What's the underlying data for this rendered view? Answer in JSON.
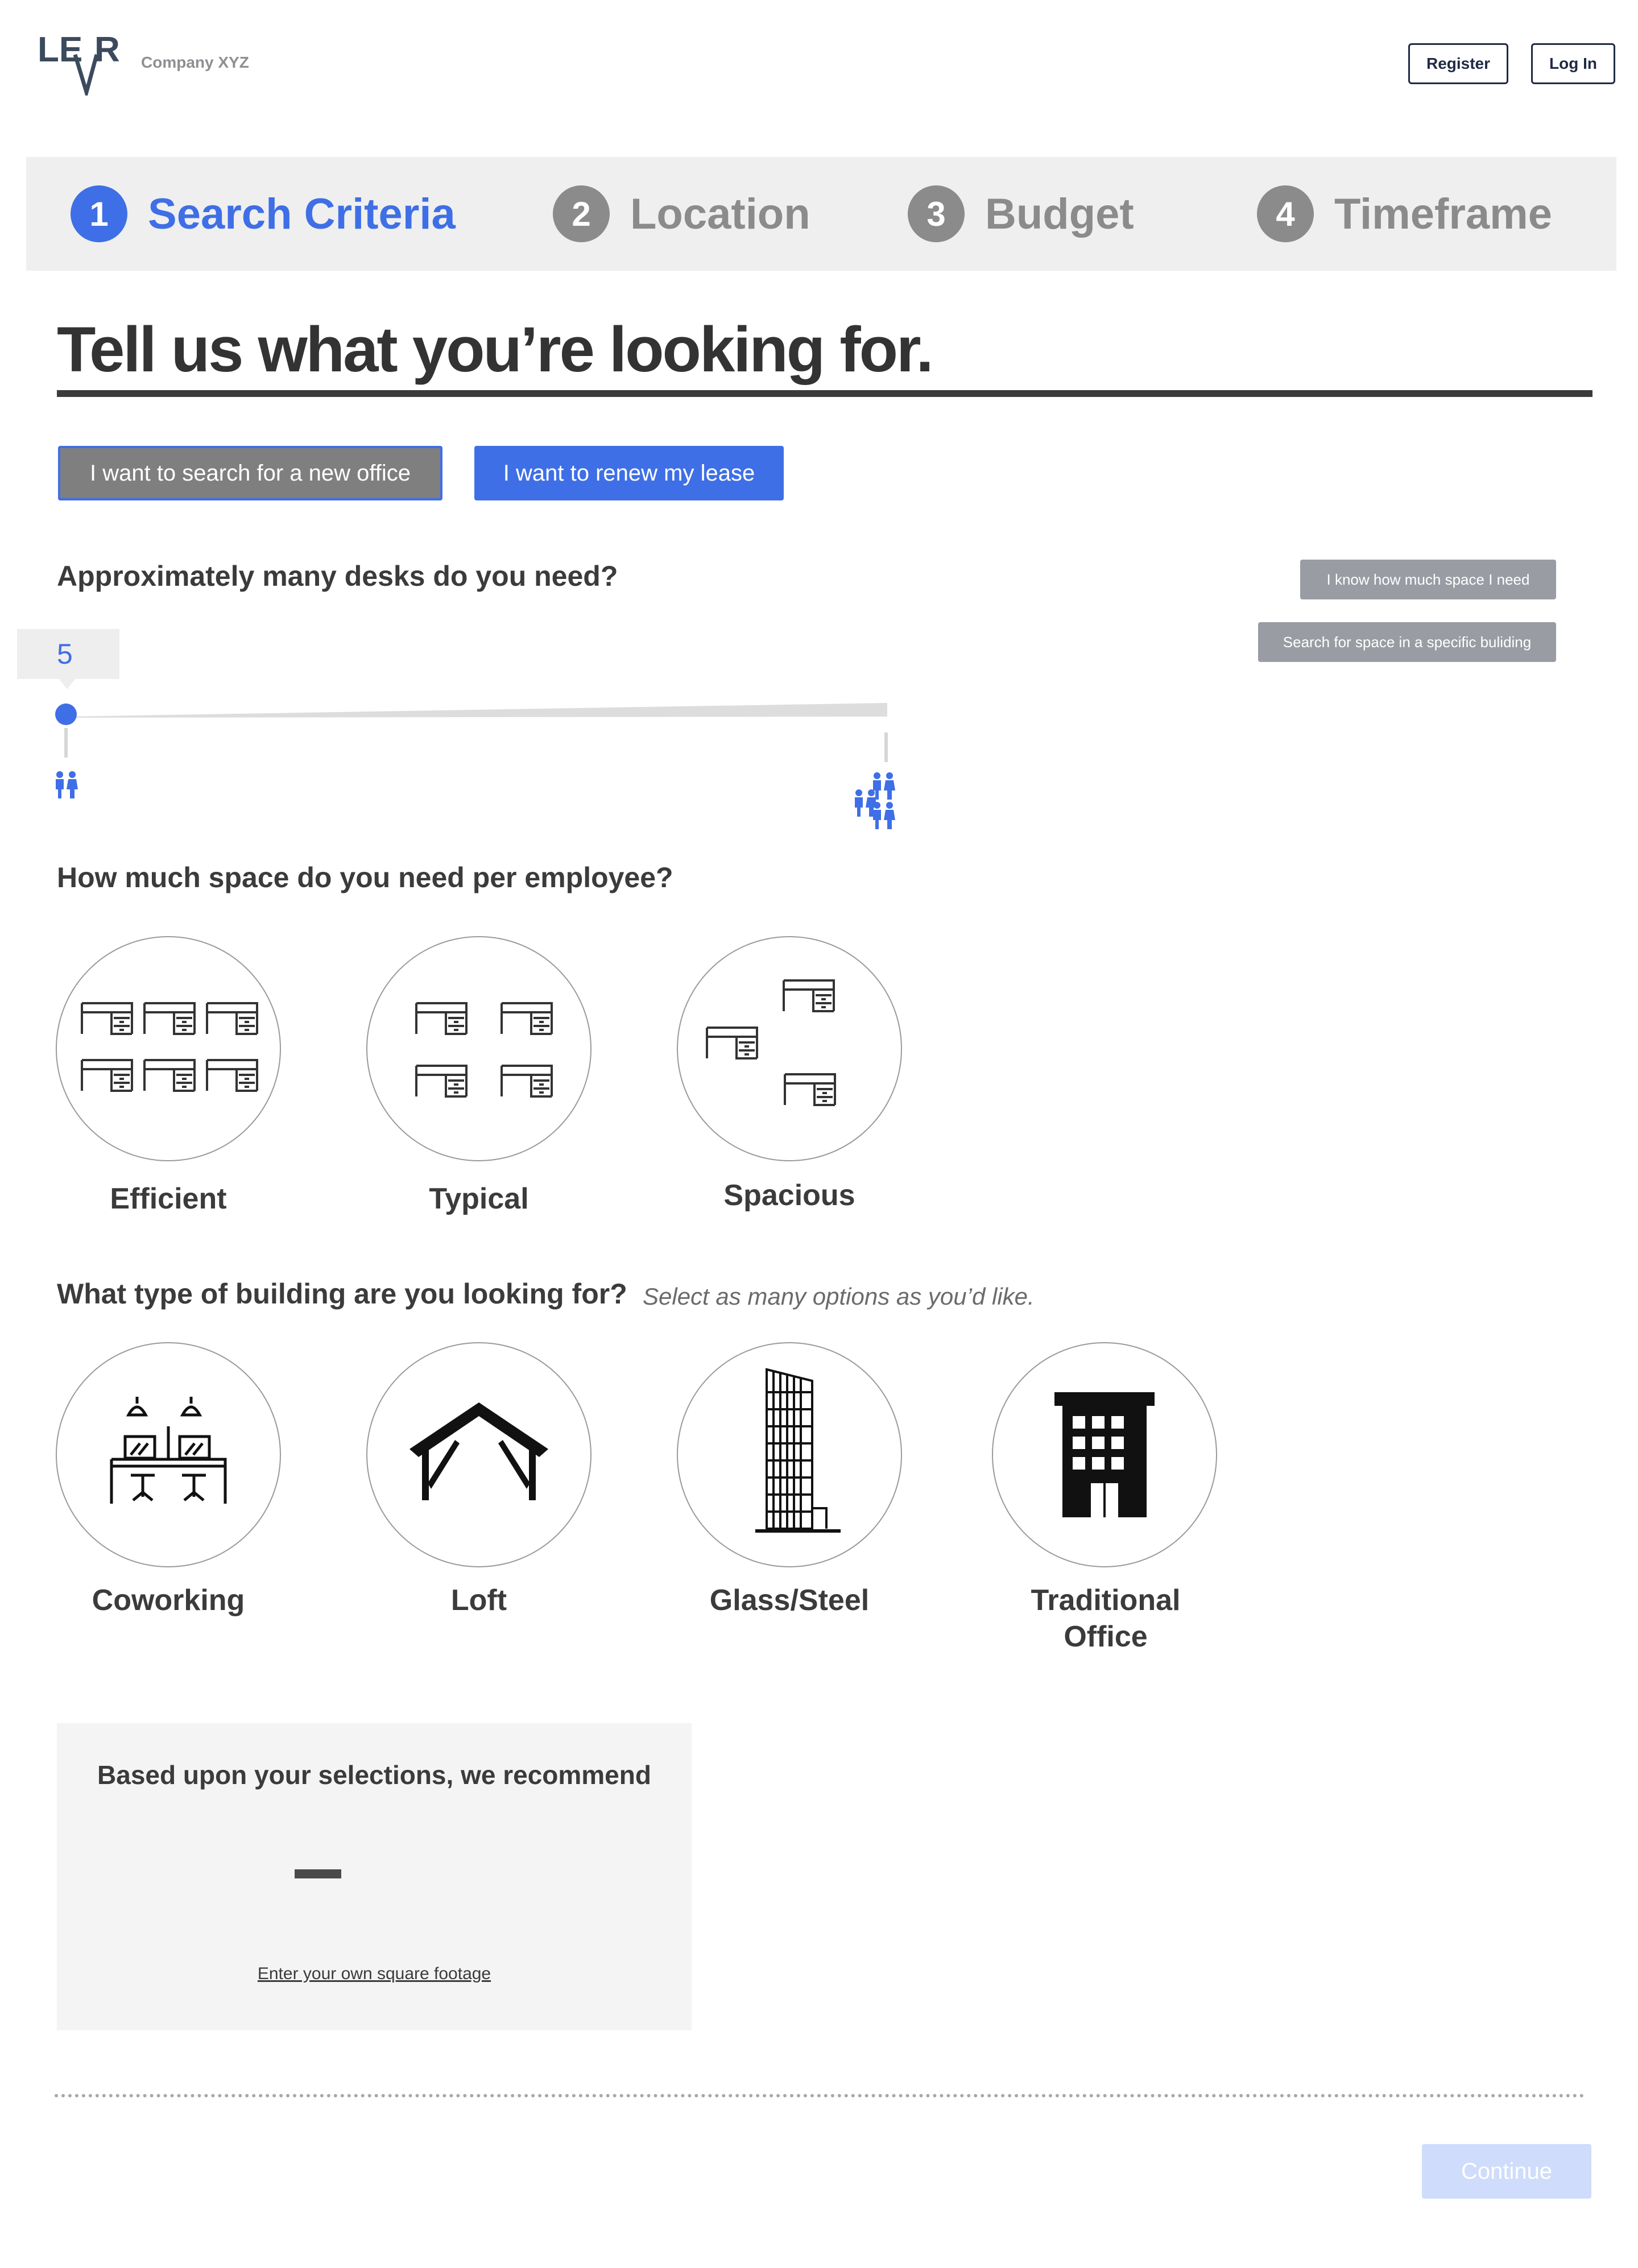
{
  "header": {
    "logo_text": "LEVR",
    "company": "Company XYZ",
    "register_label": "Register",
    "login_label": "Log In"
  },
  "steps": [
    {
      "number": "1",
      "label": "Search Criteria",
      "active": true
    },
    {
      "number": "2",
      "label": "Location",
      "active": false
    },
    {
      "number": "3",
      "label": "Budget",
      "active": false
    },
    {
      "number": "4",
      "label": "Timeframe",
      "active": false
    }
  ],
  "page_title": "Tell us what you’re looking for.",
  "mode_buttons": {
    "new_office": "I want to search for a new office",
    "renew": "I want to renew my lease"
  },
  "desks": {
    "question": "Approximately many desks do you need?",
    "value": "5",
    "know_space_button": "I know how much space I need",
    "specific_building_button": "Search for space in a specific buliding"
  },
  "space": {
    "question": "How much space do you need per employee?",
    "options": [
      {
        "label": "Efficient",
        "icon": "efficient-desks-icon"
      },
      {
        "label": "Typical",
        "icon": "typical-desks-icon"
      },
      {
        "label": "Spacious",
        "icon": "spacious-desks-icon"
      }
    ]
  },
  "building": {
    "question": "What type of building are you looking for?",
    "hint": "Select as many options as you’d like.",
    "options": [
      {
        "label": "Coworking",
        "icon": "coworking-icon"
      },
      {
        "label": "Loft",
        "icon": "loft-icon"
      },
      {
        "label": "Glass/Steel",
        "icon": "glass-steel-tower-icon"
      },
      {
        "label_line1": "Traditional",
        "label_line2": "Office",
        "icon": "traditional-office-icon"
      }
    ]
  },
  "recommendation": {
    "title": "Based upon your selections, we recommend",
    "value": "–",
    "link": "Enter your own square footage"
  },
  "footer": {
    "continue_label": "Continue"
  },
  "colors": {
    "accent": "#3f6fe6",
    "inactive": "#8b8b8b",
    "text": "#3b3b3b",
    "continue_disabled": "#cfdcfb"
  }
}
